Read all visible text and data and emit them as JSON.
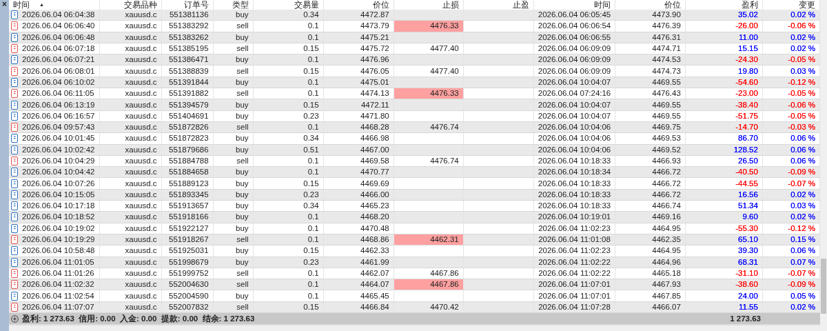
{
  "panel": {
    "close": "×"
  },
  "table": {
    "columns": [
      "时间",
      "交易品种",
      "订单号",
      "类型",
      "交易量",
      "价位",
      "止损",
      "止盈",
      "时间",
      "价位",
      "盈利",
      "变更"
    ],
    "sort_indicator": "▲",
    "rows": [
      {
        "kind": "buy",
        "time": "2026.06.04 06:04:38",
        "symbol": "xauusd.c",
        "order": "551381136",
        "type": "buy",
        "volume": "0.34",
        "price": "4472.87",
        "close_time": "2026.06.04 06:05:45",
        "close_price": "4473.90",
        "profit": "35.02",
        "change": "0.02 %",
        "color": "#0000ff"
      },
      {
        "kind": "sell",
        "time": "2026.06.04 06:06:40",
        "symbol": "xauusd.c",
        "order": "551383292",
        "type": "sell",
        "volume": "0.1",
        "price": "4473.79",
        "sl": "4476.33",
        "sl_hit": true,
        "close_time": "2026.06.04 06:06:54",
        "close_price": "4476.39",
        "profit": "-26.00",
        "change": "-0.06 %",
        "color": "#ff0000"
      },
      {
        "kind": "buy",
        "time": "2026.06.04 06:06:48",
        "symbol": "xauusd.c",
        "order": "551383262",
        "type": "buy",
        "volume": "0.1",
        "price": "4475.21",
        "close_time": "2026.06.04 06:06:55",
        "close_price": "4476.31",
        "profit": "11.00",
        "change": "0.02 %",
        "color": "#0000ff"
      },
      {
        "kind": "sell",
        "time": "2026.06.04 06:07:18",
        "symbol": "xauusd.c",
        "order": "551385195",
        "type": "sell",
        "volume": "0.15",
        "price": "4475.72",
        "sl": "4477.40",
        "sl_hit": false,
        "close_time": "2026.06.04 06:09:09",
        "close_price": "4474.71",
        "profit": "15.15",
        "change": "0.02 %",
        "color": "#0000ff"
      },
      {
        "kind": "buy",
        "time": "2026.06.04 06:07:21",
        "symbol": "xauusd.c",
        "order": "551386471",
        "type": "buy",
        "volume": "0.1",
        "price": "4476.96",
        "close_time": "2026.06.04 06:09:09",
        "close_price": "4474.53",
        "profit": "-24.30",
        "change": "-0.05 %",
        "color": "#ff0000"
      },
      {
        "kind": "sell",
        "time": "2026.06.04 06:08:01",
        "symbol": "xauusd.c",
        "order": "551388839",
        "type": "sell",
        "volume": "0.15",
        "price": "4476.05",
        "sl": "4477.40",
        "sl_hit": false,
        "close_time": "2026.06.04 06:09:09",
        "close_price": "4474.73",
        "profit": "19.80",
        "change": "0.03 %",
        "color": "#0000ff"
      },
      {
        "kind": "buy",
        "time": "2026.06.04 06:10:02",
        "symbol": "xauusd.c",
        "order": "551391844",
        "type": "buy",
        "volume": "0.1",
        "price": "4475.01",
        "close_time": "2026.06.04 10:04:07",
        "close_price": "4469.55",
        "profit": "-54.60",
        "change": "-0.12 %",
        "color": "#ff0000"
      },
      {
        "kind": "sell",
        "time": "2026.06.04 06:11:05",
        "symbol": "xauusd.c",
        "order": "551391882",
        "type": "sell",
        "volume": "0.1",
        "price": "4474.13",
        "sl": "4476.33",
        "sl_hit": true,
        "close_time": "2026.06.04 07:24:16",
        "close_price": "4476.43",
        "profit": "-23.00",
        "change": "-0.05 %",
        "color": "#ff0000"
      },
      {
        "kind": "buy",
        "time": "2026.06.04 06:13:19",
        "symbol": "xauusd.c",
        "order": "551394579",
        "type": "buy",
        "volume": "0.15",
        "price": "4472.11",
        "close_time": "2026.06.04 10:04:07",
        "close_price": "4469.55",
        "profit": "-38.40",
        "change": "-0.06 %",
        "color": "#ff0000"
      },
      {
        "kind": "buy",
        "time": "2026.06.04 06:16:57",
        "symbol": "xauusd.c",
        "order": "551404691",
        "type": "buy",
        "volume": "0.23",
        "price": "4471.80",
        "close_time": "2026.06.04 10:04:07",
        "close_price": "4469.55",
        "profit": "-51.75",
        "change": "-0.05 %",
        "color": "#ff0000"
      },
      {
        "kind": "sell",
        "time": "2026.06.04 09:57:43",
        "symbol": "xauusd.c",
        "order": "551872826",
        "type": "sell",
        "volume": "0.1",
        "price": "4468.28",
        "sl": "4476.74",
        "sl_hit": false,
        "close_time": "2026.06.04 10:04:06",
        "close_price": "4469.75",
        "profit": "-14.70",
        "change": "-0.03 %",
        "color": "#ff0000"
      },
      {
        "kind": "buy",
        "time": "2026.06.04 10:01:45",
        "symbol": "xauusd.c",
        "order": "551872823",
        "type": "buy",
        "volume": "0.34",
        "price": "4466.98",
        "close_time": "2026.06.04 10:04:06",
        "close_price": "4469.53",
        "profit": "86.70",
        "change": "0.06 %",
        "color": "#0000ff"
      },
      {
        "kind": "buy",
        "time": "2026.06.04 10:02:42",
        "symbol": "xauusd.c",
        "order": "551879686",
        "type": "buy",
        "volume": "0.51",
        "price": "4467.00",
        "close_time": "2026.06.04 10:04:06",
        "close_price": "4469.52",
        "profit": "128.52",
        "change": "0.06 %",
        "color": "#0000ff"
      },
      {
        "kind": "sell",
        "time": "2026.06.04 10:04:29",
        "symbol": "xauusd.c",
        "order": "551884788",
        "type": "sell",
        "volume": "0.1",
        "price": "4469.58",
        "sl": "4476.74",
        "sl_hit": false,
        "close_time": "2026.06.04 10:18:33",
        "close_price": "4466.93",
        "profit": "26.50",
        "change": "0.06 %",
        "color": "#0000ff"
      },
      {
        "kind": "buy",
        "time": "2026.06.04 10:04:42",
        "symbol": "xauusd.c",
        "order": "551884658",
        "type": "buy",
        "volume": "0.1",
        "price": "4470.77",
        "close_time": "2026.06.04 10:18:34",
        "close_price": "4466.72",
        "profit": "-40.50",
        "change": "-0.09 %",
        "color": "#ff0000"
      },
      {
        "kind": "buy",
        "time": "2026.06.04 10:07:26",
        "symbol": "xauusd.c",
        "order": "551889123",
        "type": "buy",
        "volume": "0.15",
        "price": "4469.69",
        "close_time": "2026.06.04 10:18:33",
        "close_price": "4466.72",
        "profit": "-44.55",
        "change": "-0.07 %",
        "color": "#ff0000"
      },
      {
        "kind": "buy",
        "time": "2026.06.04 10:15:05",
        "symbol": "xauusd.c",
        "order": "551893345",
        "type": "buy",
        "volume": "0.23",
        "price": "4466.00",
        "close_time": "2026.06.04 10:18:33",
        "close_price": "4466.72",
        "profit": "16.56",
        "change": "0.02 %",
        "color": "#0000ff"
      },
      {
        "kind": "buy",
        "time": "2026.06.04 10:17:18",
        "symbol": "xauusd.c",
        "order": "551913657",
        "type": "buy",
        "volume": "0.34",
        "price": "4465.23",
        "close_time": "2026.06.04 10:18:33",
        "close_price": "4466.74",
        "profit": "51.34",
        "change": "0.03 %",
        "color": "#0000ff"
      },
      {
        "kind": "buy",
        "time": "2026.06.04 10:18:52",
        "symbol": "xauusd.c",
        "order": "551918166",
        "type": "buy",
        "volume": "0.1",
        "price": "4468.20",
        "close_time": "2026.06.04 10:19:01",
        "close_price": "4469.16",
        "profit": "9.60",
        "change": "0.02 %",
        "color": "#0000ff"
      },
      {
        "kind": "buy",
        "time": "2026.06.04 10:19:02",
        "symbol": "xauusd.c",
        "order": "551922127",
        "type": "buy",
        "volume": "0.1",
        "price": "4470.48",
        "close_time": "2026.06.04 11:02:23",
        "close_price": "4464.95",
        "profit": "-55.30",
        "change": "-0.12 %",
        "color": "#ff0000"
      },
      {
        "kind": "sell",
        "time": "2026.06.04 10:19:29",
        "symbol": "xauusd.c",
        "order": "551918267",
        "type": "sell",
        "volume": "0.1",
        "price": "4468.86",
        "sl": "4462.31",
        "sl_hit": true,
        "close_time": "2026.06.04 11:01:08",
        "close_price": "4462.35",
        "profit": "65.10",
        "change": "0.15 %",
        "color": "#0000ff"
      },
      {
        "kind": "buy",
        "time": "2026.06.04 10:58:48",
        "symbol": "xauusd.c",
        "order": "551925031",
        "type": "buy",
        "volume": "0.15",
        "price": "4462.33",
        "close_time": "2026.06.04 11:02:23",
        "close_price": "4464.95",
        "profit": "39.30",
        "change": "0.06 %",
        "color": "#0000ff"
      },
      {
        "kind": "buy",
        "time": "2026.06.04 11:01:05",
        "symbol": "xauusd.c",
        "order": "551998679",
        "type": "buy",
        "volume": "0.23",
        "price": "4461.99",
        "close_time": "2026.06.04 11:02:22",
        "close_price": "4464.96",
        "profit": "68.31",
        "change": "0.07 %",
        "color": "#0000ff"
      },
      {
        "kind": "sell",
        "time": "2026.06.04 11:01:26",
        "symbol": "xauusd.c",
        "order": "551999752",
        "type": "sell",
        "volume": "0.1",
        "price": "4462.07",
        "sl": "4467.86",
        "sl_hit": false,
        "close_time": "2026.06.04 11:02:22",
        "close_price": "4465.18",
        "profit": "-31.10",
        "change": "-0.07 %",
        "color": "#ff0000"
      },
      {
        "kind": "sell",
        "time": "2026.06.04 11:02:32",
        "symbol": "xauusd.c",
        "order": "552004630",
        "type": "sell",
        "volume": "0.1",
        "price": "4464.07",
        "sl": "4467.86",
        "sl_hit": true,
        "close_time": "2026.06.04 11:07:01",
        "close_price": "4467.93",
        "profit": "-38.60",
        "change": "-0.09 %",
        "color": "#ff0000"
      },
      {
        "kind": "buy",
        "time": "2026.06.04 11:02:54",
        "symbol": "xauusd.c",
        "order": "552004590",
        "type": "buy",
        "volume": "0.1",
        "price": "4465.45",
        "close_time": "2026.06.04 11:07:01",
        "close_price": "4467.85",
        "profit": "24.00",
        "change": "0.05 %",
        "color": "#0000ff"
      },
      {
        "kind": "sell",
        "time": "2026.06.04 11:07:07",
        "symbol": "xauusd.c",
        "order": "552007832",
        "type": "sell",
        "volume": "0.15",
        "price": "4466.84",
        "sl": "4470.42",
        "sl_hit": false,
        "close_time": "2026.06.04 11:07:28",
        "close_price": "4466.07",
        "profit": "11.55",
        "change": "0.02 %",
        "color": "#0000ff"
      }
    ]
  },
  "summary": {
    "text": "盈利: 1 273.63  信用: 0.00  入金: 0.00  提款: 0.00  结余: 1 273.63",
    "total": "1 273.63"
  }
}
